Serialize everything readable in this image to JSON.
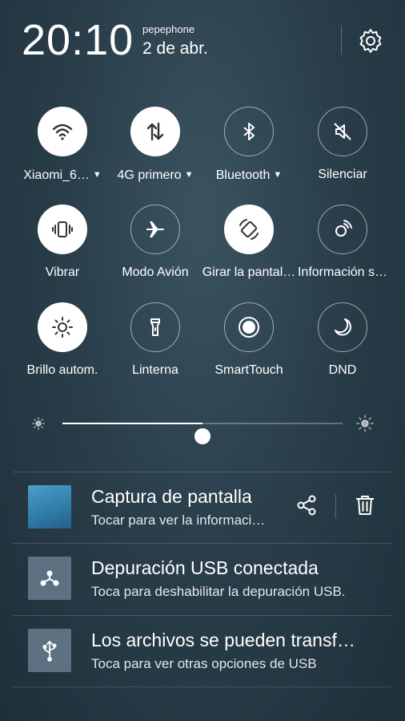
{
  "status": {
    "time": "20:10",
    "carrier": "pepephone",
    "date": "2 de abr."
  },
  "header": {
    "settings_icon": "gear-icon"
  },
  "quick_settings": [
    {
      "label": "Xiaomi_6…",
      "icon": "wifi-icon",
      "active": true,
      "dropdown": true
    },
    {
      "label": "4G primero",
      "icon": "mobile-data-icon",
      "active": true,
      "dropdown": true
    },
    {
      "label": "Bluetooth",
      "icon": "bluetooth-icon",
      "active": false,
      "dropdown": true
    },
    {
      "label": "Silenciar",
      "icon": "mute-icon",
      "active": false,
      "dropdown": false
    },
    {
      "label": "Vibrar",
      "icon": "vibrate-icon",
      "active": true,
      "dropdown": false
    },
    {
      "label": "Modo Avión",
      "icon": "airplane-icon",
      "active": false,
      "dropdown": false
    },
    {
      "label": "Girar la pantal…",
      "icon": "auto-rotate-icon",
      "active": true,
      "dropdown": false
    },
    {
      "label": "Información s…",
      "icon": "location-info-icon",
      "active": false,
      "dropdown": false
    },
    {
      "label": "Brillo autom.",
      "icon": "auto-brightness-icon",
      "active": true,
      "dropdown": false
    },
    {
      "label": "Linterna",
      "icon": "flashlight-icon",
      "active": false,
      "dropdown": false
    },
    {
      "label": "SmartTouch",
      "icon": "smarttouch-icon",
      "active": false,
      "dropdown": false
    },
    {
      "label": "DND",
      "icon": "moon-icon",
      "active": false,
      "dropdown": false
    }
  ],
  "brightness": {
    "level": 0.5
  },
  "notifications": [
    {
      "title": "Captura de pantalla",
      "subtitle": "Tocar para ver la informaci…",
      "icon": "screenshot-thumbnail",
      "actions": [
        "share-icon",
        "trash-icon"
      ]
    },
    {
      "title": "Depuración USB conectada",
      "subtitle": "Toca para deshabilitar la depuración USB.",
      "icon": "usb-debug-icon"
    },
    {
      "title": "Los archivos se pueden transf…",
      "subtitle": "Toca para ver otras opciones de USB",
      "icon": "usb-icon"
    }
  ]
}
